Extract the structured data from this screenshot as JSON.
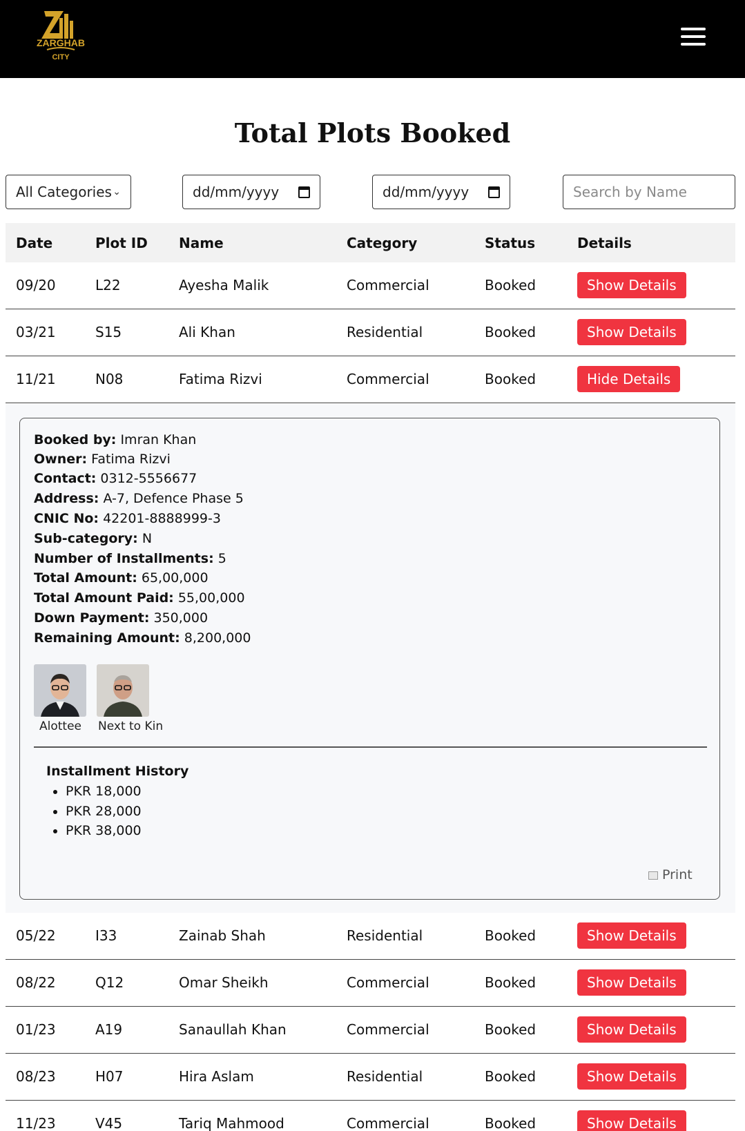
{
  "brand": {
    "logo_text_top": "ZARGHAB",
    "logo_text_bottom": "CITY",
    "accent": "#d4a32a"
  },
  "page_title": "Total Plots Booked",
  "filters": {
    "category_value": "All Categories",
    "date_from_placeholder": "dd/mm/yyyy",
    "date_to_placeholder": "dd/mm/yyyy",
    "search_placeholder": "Search by Name"
  },
  "table": {
    "headers": [
      "Date",
      "Plot ID",
      "Name",
      "Category",
      "Status",
      "Details"
    ],
    "rows": [
      {
        "date": "09/20",
        "plot_id": "L22",
        "name": "Ayesha Malik",
        "category": "Commercial",
        "status": "Booked",
        "action": "Show Details"
      },
      {
        "date": "03/21",
        "plot_id": "S15",
        "name": "Ali Khan",
        "category": "Residential",
        "status": "Booked",
        "action": "Show Details"
      },
      {
        "date": "11/21",
        "plot_id": "N08",
        "name": "Fatima Rizvi",
        "category": "Commercial",
        "status": "Booked",
        "action": "Hide Details"
      },
      {
        "date": "05/22",
        "plot_id": "I33",
        "name": "Zainab Shah",
        "category": "Residential",
        "status": "Booked",
        "action": "Show Details"
      },
      {
        "date": "08/22",
        "plot_id": "Q12",
        "name": "Omar Sheikh",
        "category": "Commercial",
        "status": "Booked",
        "action": "Show Details"
      },
      {
        "date": "01/23",
        "plot_id": "A19",
        "name": "Sanaullah Khan",
        "category": "Commercial",
        "status": "Booked",
        "action": "Show Details"
      },
      {
        "date": "08/23",
        "plot_id": "H07",
        "name": "Hira Aslam",
        "category": "Residential",
        "status": "Booked",
        "action": "Show Details"
      },
      {
        "date": "11/23",
        "plot_id": "V45",
        "name": "Tariq Mahmood",
        "category": "Commercial",
        "status": "Booked",
        "action": "Show Details"
      }
    ]
  },
  "details": {
    "fields": [
      {
        "label": "Booked by:",
        "value": "Imran Khan"
      },
      {
        "label": "Owner:",
        "value": "Fatima Rizvi"
      },
      {
        "label": "Contact:",
        "value": "0312-5556677"
      },
      {
        "label": "Address:",
        "value": "A-7, Defence Phase 5"
      },
      {
        "label": "CNIC No:",
        "value": "42201-8888999-3"
      },
      {
        "label": "Sub-category:",
        "value": "N"
      },
      {
        "label": "Number of Installments:",
        "value": "5"
      },
      {
        "label": "Total Amount:",
        "value": "65,00,000"
      },
      {
        "label": "Total Amount Paid:",
        "value": "55,00,000"
      },
      {
        "label": "Down Payment:",
        "value": "350,000"
      },
      {
        "label": "Remaining Amount:",
        "value": "8,200,000"
      }
    ],
    "photos": [
      {
        "caption": "Alottee"
      },
      {
        "caption": "Next to Kin"
      }
    ],
    "installment_title": "Installment History",
    "installments": [
      "PKR 18,000",
      "PKR 28,000",
      "PKR 38,000"
    ],
    "print_label": "Print"
  },
  "colors": {
    "button": "#f03440",
    "header_bg": "#000000"
  }
}
